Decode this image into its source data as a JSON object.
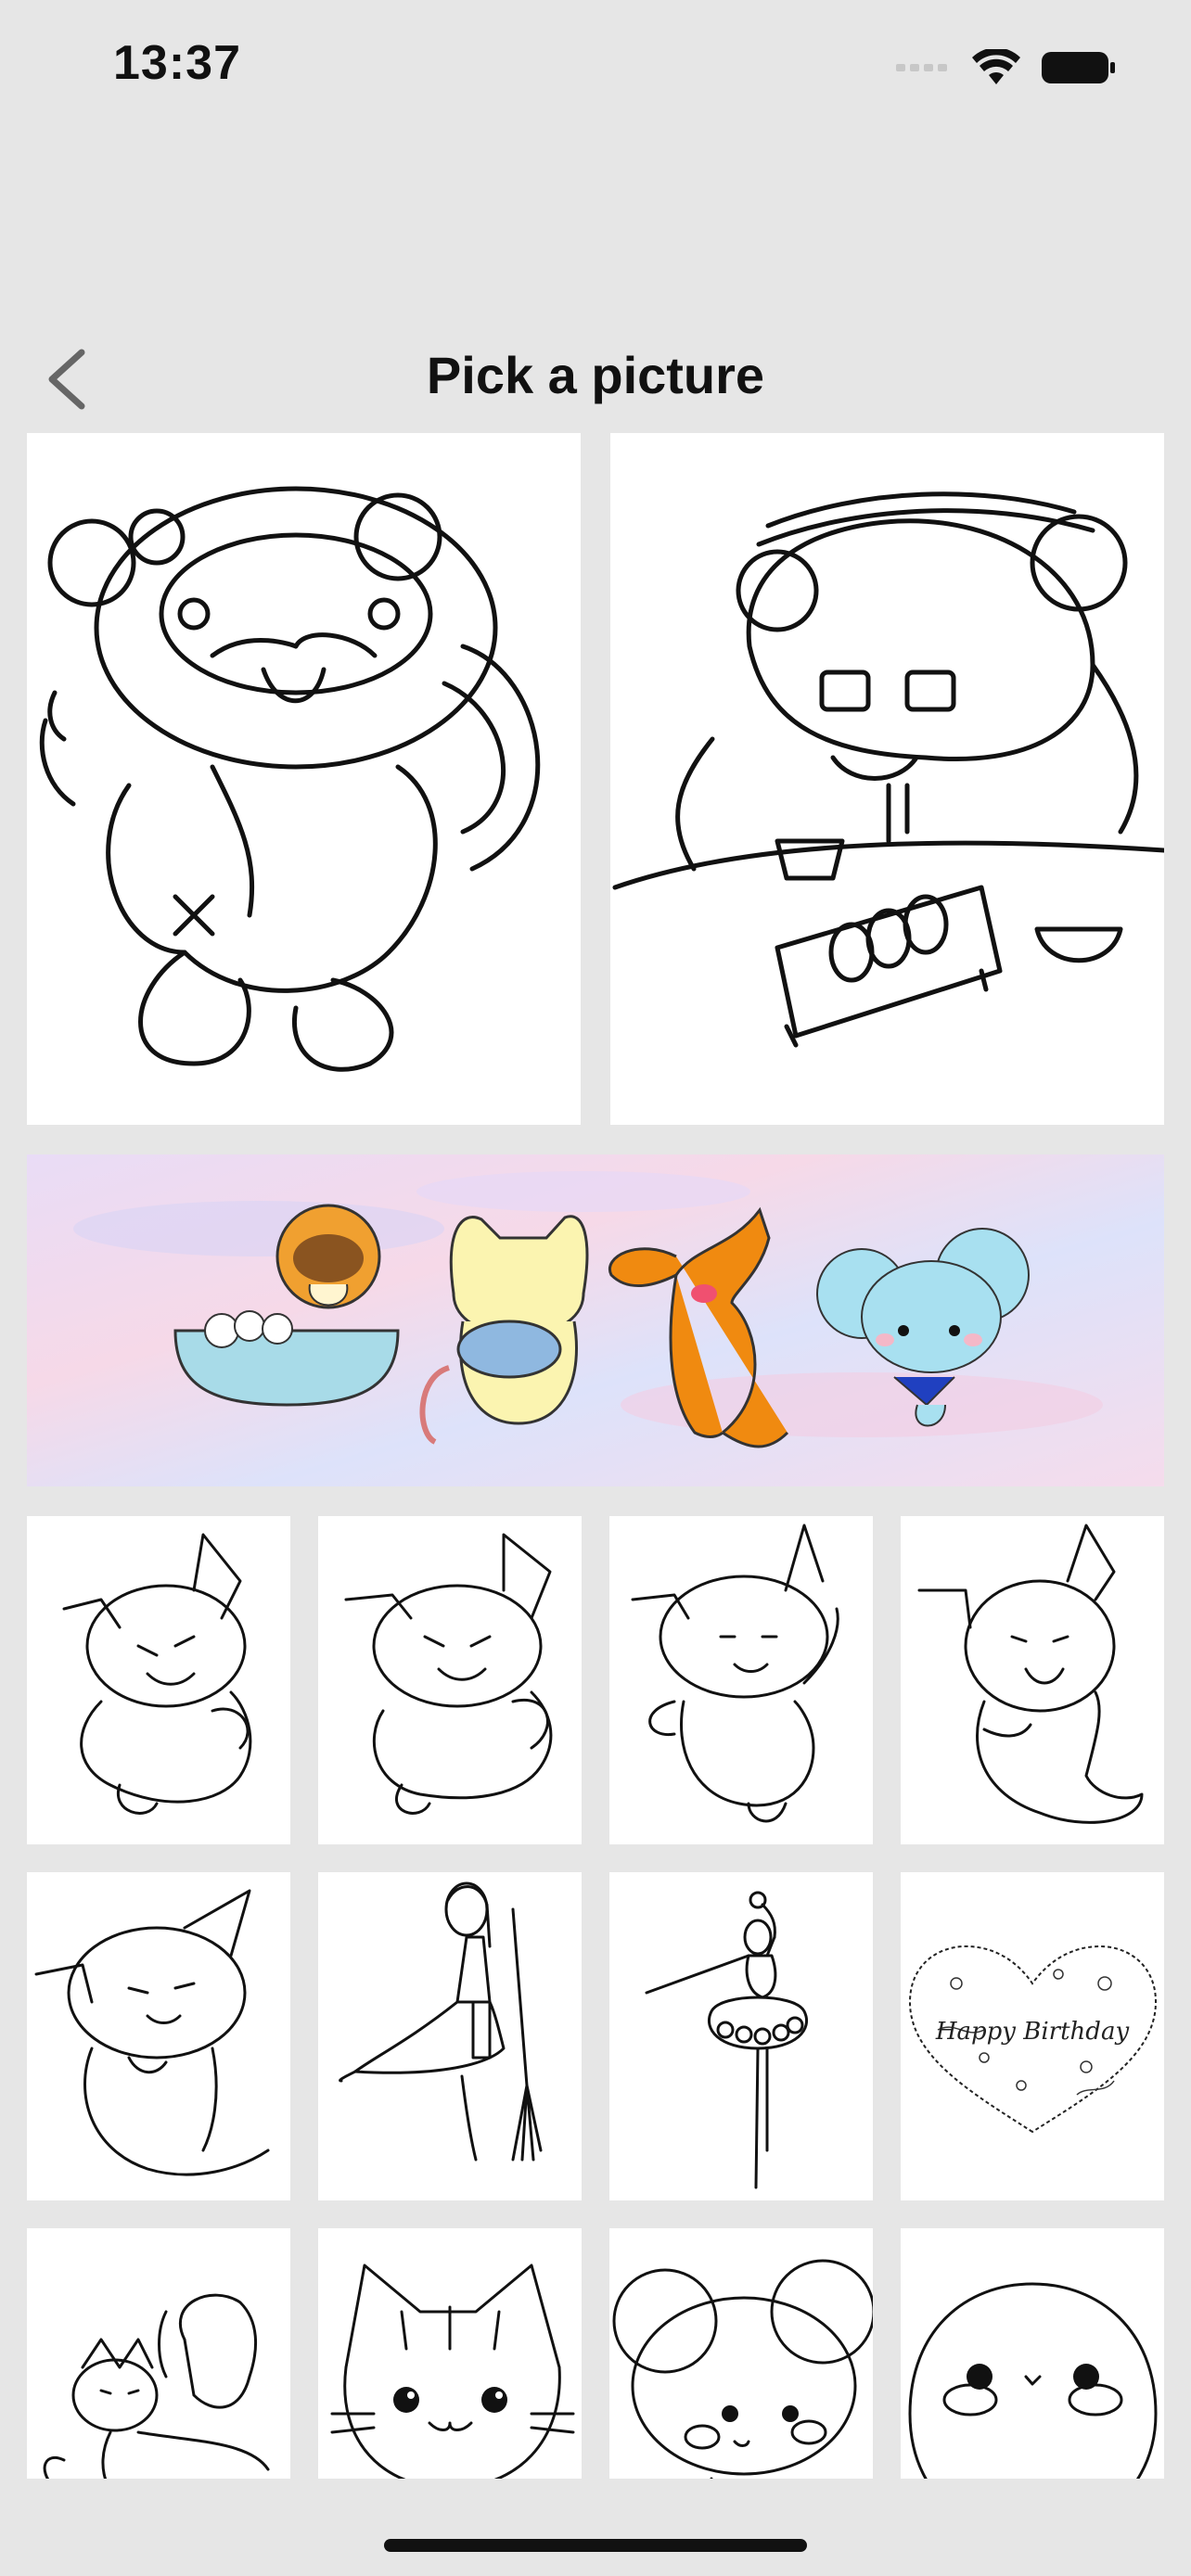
{
  "status_bar": {
    "time": "13:37",
    "icons": [
      "signal-icon",
      "wifi-icon",
      "battery-icon"
    ]
  },
  "nav": {
    "back_icon": "chevron-left-icon",
    "title": "Pick a picture"
  },
  "gallery": {
    "featured": [
      {
        "name": "tanuki-dancing",
        "style": "line-art"
      },
      {
        "name": "tanuki-eating-sushi",
        "style": "line-art"
      }
    ],
    "banner": {
      "name": "colored-animals-banner",
      "text": ""
    },
    "rows": [
      [
        "dog-laughing-1",
        "dog-laughing-2",
        "dog-waving",
        "dog-smiling"
      ],
      [
        "dog-sitting",
        "girl-with-broom",
        "ballerina",
        "happy-birthday-heart"
      ],
      [
        "girl-hugging-cat",
        "cat-face",
        "mouse-face",
        "round-creature"
      ]
    ],
    "birthday_text": "Happy Birthday"
  }
}
